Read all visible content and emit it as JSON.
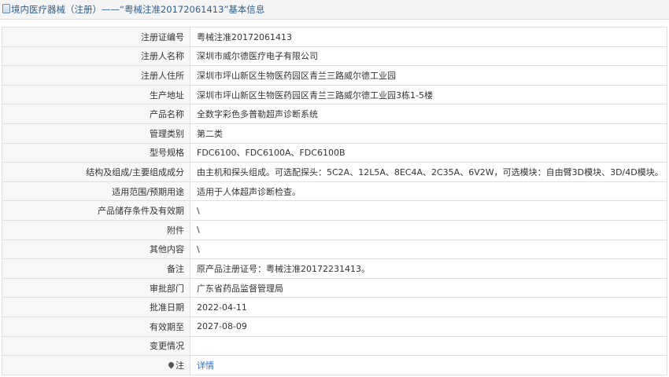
{
  "header": {
    "icon": "document-icon",
    "title": "境内医疗器械（注册）——“粤械注准20172061413”基本信息"
  },
  "rows": [
    {
      "label": "注册证编号",
      "value": "粤械注准20172061413"
    },
    {
      "label": "注册人名称",
      "value": "深圳市威尔德医疗电子有限公司"
    },
    {
      "label": "注册人住所",
      "value": "深圳市坪山新区生物医药园区青兰三路威尔德工业园"
    },
    {
      "label": "生产地址",
      "value": "深圳市坪山新区生物医药园区青兰三路威尔德工业园3栋1-5楼"
    },
    {
      "label": "产品名称",
      "value": "全数字彩色多普勒超声诊断系统"
    },
    {
      "label": "管理类别",
      "value": "第二类"
    },
    {
      "label": "型号规格",
      "value": "FDC6100、FDC6100A、FDC6100B"
    },
    {
      "label": "结构及组成/主要组成成分",
      "value": "由主机和探头组成。可选配探头：5C2A、12L5A、8EC4A、2C35A、6V2W，可选模块：自由臂3D模块、3D/4D模块。"
    },
    {
      "label": "适用范围/预期用途",
      "value": "适用于人体超声诊断检查。"
    },
    {
      "label": "产品储存条件及有效期",
      "value": "\\"
    },
    {
      "label": "附件",
      "value": "\\"
    },
    {
      "label": "其他内容",
      "value": "\\"
    },
    {
      "label": "备注",
      "value": "原产品注册证号：粤械注准20172231413。"
    },
    {
      "label": "审批部门",
      "value": "广东省药品监督管理局"
    },
    {
      "label": "批准日期",
      "value": "2022-04-11"
    },
    {
      "label": "有效期至",
      "value": "2027-08-09"
    },
    {
      "label": "变更情况",
      "value": ""
    }
  ],
  "note_row": {
    "icon": "pin-icon",
    "label": "注",
    "link": "详情"
  }
}
